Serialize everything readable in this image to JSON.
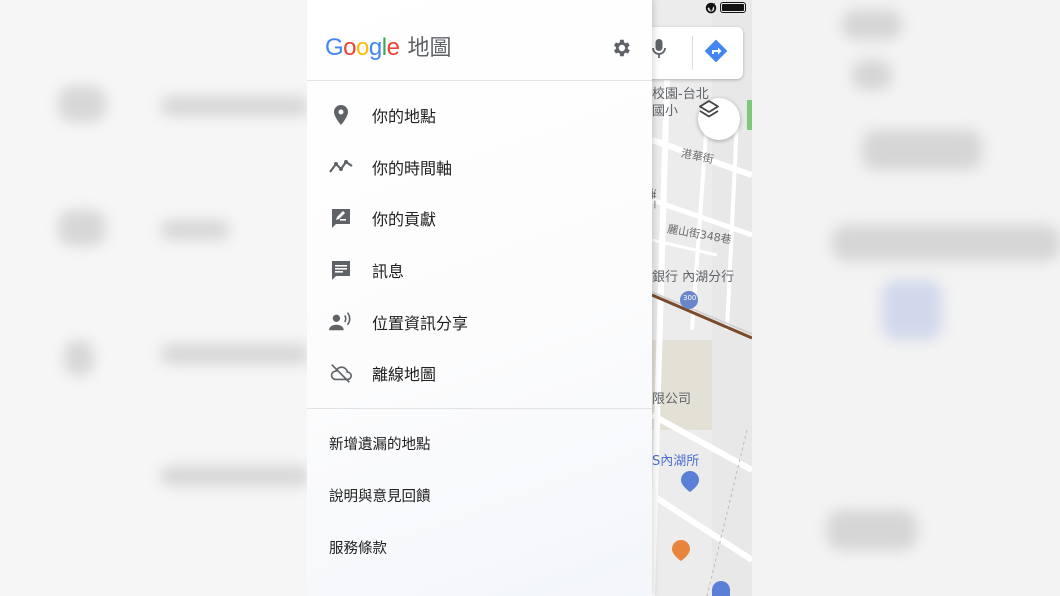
{
  "app": {
    "logo_text": "Google",
    "title": "地圖"
  },
  "header": {
    "settings_icon": "gear-icon"
  },
  "menu": {
    "items": [
      {
        "label": "你的地點",
        "icon": "place-pin-icon"
      },
      {
        "label": "你的時間軸",
        "icon": "timeline-icon"
      },
      {
        "label": "你的貢獻",
        "icon": "contribution-edit-icon"
      },
      {
        "label": "訊息",
        "icon": "message-icon"
      },
      {
        "label": "位置資訊分享",
        "icon": "location-sharing-icon"
      },
      {
        "label": "離線地圖",
        "icon": "offline-cloud-icon"
      }
    ]
  },
  "links": {
    "items": [
      {
        "label": "新增遺漏的地點"
      },
      {
        "label": "說明與意見回饋"
      },
      {
        "label": "服務條款"
      }
    ]
  },
  "map": {
    "labels": [
      {
        "text": "校園-台北"
      },
      {
        "text": "國小"
      },
      {
        "text": "港華街"
      },
      {
        "text": "港元一"
      },
      {
        "text": "麗山街348巷"
      },
      {
        "text": "銀行 內湖分行"
      },
      {
        "text": "限公司"
      },
      {
        "text": "S內湖所"
      }
    ],
    "metro_badge": "300",
    "search_icons": [
      "microphone-icon",
      "directions-icon"
    ],
    "layers_icon": "layers-icon"
  },
  "status_bar": {
    "icons": [
      "orientation-lock-icon",
      "location-arrow-icon",
      "alarm-icon",
      "battery-icon"
    ]
  },
  "colors": {
    "accent_blue": "#4285f4",
    "map_bg": "#ececec",
    "drawer_bg": "#ffffff",
    "text_primary": "#212121",
    "text_secondary": "#5f6368"
  }
}
